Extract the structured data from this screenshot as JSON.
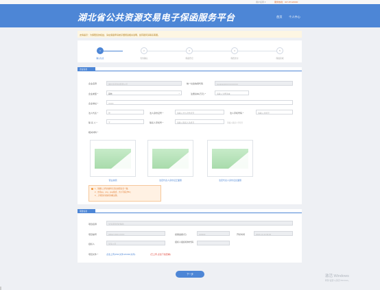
{
  "topbar": {
    "user": "用户名称 ▾",
    "hotline": "服务热线：027-87120000"
  },
  "header": {
    "title": "湖北省公共资源交易电子保函服务平台",
    "nav_home": "首页",
    "nav_user": "个人中心"
  },
  "notice": "友情提示：为保障您的权益，请在保函申请前仔细阅读相关说明，如有疑问请联系客服。",
  "steps": [
    {
      "num": "1",
      "label": "确认信息"
    },
    {
      "num": "2",
      "label": "签约确认"
    },
    {
      "num": "3",
      "label": "保函登记"
    },
    {
      "num": "4",
      "label": "保费支付"
    },
    {
      "num": "5",
      "label": "保函完成"
    }
  ],
  "company": {
    "section_title": "企业信息",
    "name_label": "企业名称",
    "name_value": "湖北某某建设有限公司",
    "credit_label": "统一社会信用代码",
    "credit_value": "91420100XXXXXXXXXX",
    "type_label": "企业类型 *",
    "type_value": "其他",
    "capital_label": "注册资本(万元) *",
    "capital_value": "请输入注册资本",
    "address_label": "企业地址 *",
    "address_value": "XXXX",
    "legal_label": "法人代表 *",
    "legal_value": "张",
    "legal_id_label": "法人身份证号 *",
    "legal_id_value": "请输入法人身份证号",
    "legal_phone_label": "法人手机号码 *",
    "legal_phone_value": "请输入手机号",
    "contact_label": "联 系 人 *",
    "contact_value": "王",
    "contact_phone_label": "联系人手机号 *",
    "contact_phone_value": "请输入联系人手机号",
    "contact_hint": "请输入联系人手机号",
    "materials_label": "相关材料 *"
  },
  "uploads": [
    {
      "label": "营业执照"
    },
    {
      "label": "法定代表人身份证正面照"
    },
    {
      "label": "法定代表人身份证反面照"
    }
  ],
  "warning": {
    "lines": [
      "1、请确认上传的资料与营业执照信息一致；",
      "2、支持jpg、png、jpeg格式，大小不超过5M；",
      "3、上传照片请保持清晰完整。"
    ]
  },
  "project": {
    "section_title": "项目信息",
    "name_label": "项目名称",
    "name_value": "某某项目招标保函",
    "code_label": "项目编号",
    "code_value": "HBGZ-2020-XXXX",
    "amount_label": "担保金额(元)",
    "amount_value": "100000",
    "open_label": "开标时间",
    "open_value": "2020-12-10 09:30",
    "tenderer_label": "招标人",
    "tenderer_value": "某某公司",
    "agent_label": "招标人组织机构代码",
    "agent_value": "",
    "file_label": "项目文件 *",
    "file_link": "点击上传(PDF文件/WORD文件)",
    "file_note": "(已上传,点击下载查看)"
  },
  "next_button": "下一步",
  "windows": {
    "line1": "激活 Windows",
    "line2": "转到\"设置\"以激活 Windows。"
  },
  "colors": {
    "primary": "#4d86d6",
    "warning": "#f08a24",
    "background": "#eef0f4"
  }
}
